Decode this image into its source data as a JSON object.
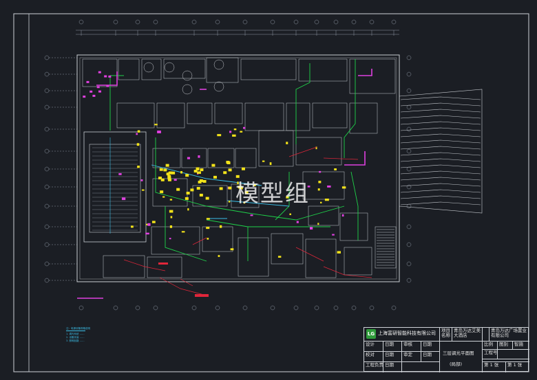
{
  "watermark": "模型组",
  "title_block": {
    "company": "上海富研智能科技有限公司",
    "logo_text": "LG",
    "project_label": "项目名称",
    "project_name": "青岛万达艾美大酒店",
    "client_label": "",
    "client_name": "青岛万达广场置业有限公司",
    "drawing_title": "三层调光平面图",
    "drawing_note": "(局部)",
    "rows": [
      {
        "label": "设计",
        "value": "日期",
        "label2": "审核",
        "value2": "日期"
      },
      {
        "label": "校对",
        "value": "日期",
        "label2": "审定",
        "value2": "日期"
      },
      {
        "label": "工程负责人",
        "value": "日期",
        "label2": "",
        "value2": ""
      }
    ],
    "scale_label": "比例",
    "scale_value": "图别",
    "scale_value2": "智施",
    "drawing_no_label": "工程号",
    "sheet_label": "第 1 张",
    "sheet_total": "第 1 张"
  },
  "legend": {
    "lines": [
      "注：电源设备规格说明",
      "1. 调光系统 ……",
      "2. 设备安装 ……",
      "3. 照明回路 ……"
    ]
  },
  "colors": {
    "background": "#1b1e24",
    "walls": "#c9cdd2",
    "green": "#1fd34a",
    "magenta": "#e040e0",
    "yellow": "#f2e21a",
    "red": "#e0263a",
    "cyan": "#3bbfe8",
    "blue": "#3a62e8"
  },
  "icons": {
    "logo": "company-logo-icon"
  }
}
